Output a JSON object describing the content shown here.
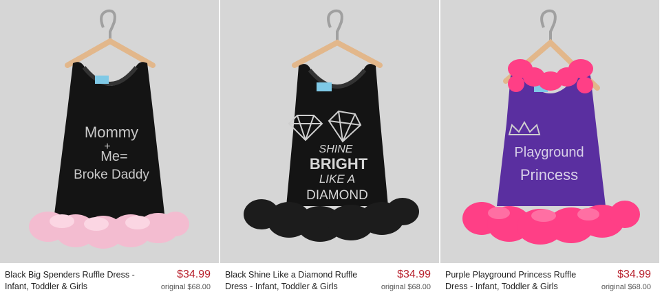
{
  "products": [
    {
      "title": "Black Big Spenders Ruffle Dress - Infant, Toddler & Girls",
      "price": "$34.99",
      "original_label": "original",
      "original_price": "$68.00",
      "print_lines": [
        "Mommy",
        "+",
        "Me=",
        "Broke Daddy"
      ],
      "colors": {
        "dress": "#141414",
        "ruffle": "#f3bcd0",
        "print": "#c9c9c9"
      }
    },
    {
      "title": "Black Shine Like a Diamond Ruffle Dress - Infant, Toddler & Girls",
      "price": "$34.99",
      "original_label": "original",
      "original_price": "$68.00",
      "print_lines": [
        "SHINE",
        "BRIGHT",
        "LIKE A",
        "DIAMOND"
      ],
      "colors": {
        "dress": "#141414",
        "ruffle": "#1c1c1c",
        "print": "#d6d6d6"
      }
    },
    {
      "title": "Purple Playground Princess Ruffle Dress - Infant, Toddler & Girls",
      "price": "$34.99",
      "original_label": "original",
      "original_price": "$68.00",
      "print_lines": [
        "Playground",
        "Princess"
      ],
      "colors": {
        "dress": "#5a2fa0",
        "ruffle": "#ff3f86",
        "print": "#d8d0e8"
      }
    }
  ],
  "colors": {
    "price": "#b8202c",
    "photo_bg": "#d6d6d6"
  }
}
